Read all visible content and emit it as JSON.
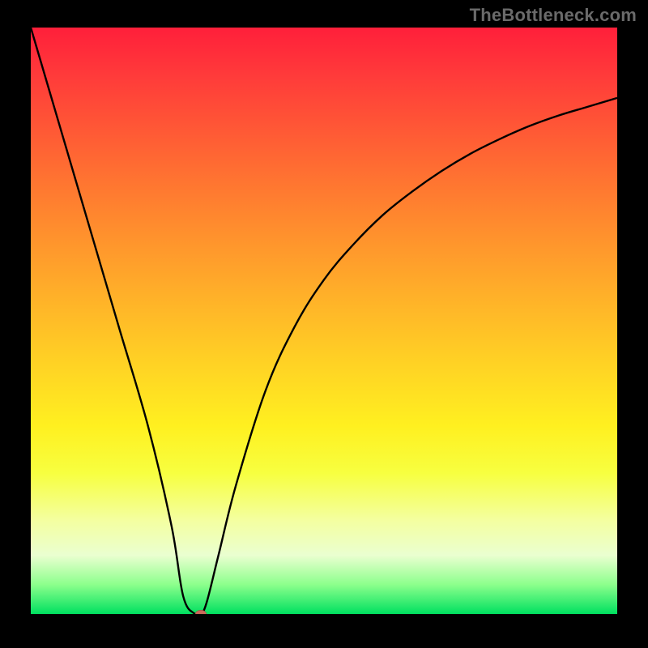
{
  "watermark": "TheBottleneck.com",
  "colors": {
    "page_bg": "#000000",
    "watermark": "#6a6a6a",
    "curve": "#000000",
    "marker": "#c96a5a",
    "gradient_stops": [
      "#ff1f3a",
      "#ff3a3a",
      "#ff5a35",
      "#ff7a30",
      "#ff992c",
      "#ffb728",
      "#ffd424",
      "#fff020",
      "#f7ff40",
      "#f4ffa0",
      "#eaffd0",
      "#8cff8c",
      "#00e060"
    ]
  },
  "chart_data": {
    "type": "line",
    "title": "",
    "xlabel": "",
    "ylabel": "",
    "xlim": [
      0,
      100
    ],
    "ylim": [
      0,
      100
    ],
    "grid": false,
    "legend": false,
    "x": [
      0,
      5,
      10,
      15,
      20,
      24,
      26,
      28,
      29,
      30,
      32,
      35,
      40,
      45,
      50,
      55,
      60,
      65,
      70,
      75,
      80,
      85,
      90,
      95,
      100
    ],
    "series": [
      {
        "name": "curve",
        "color": "#000000",
        "values": [
          100,
          83,
          66,
          49,
          32,
          15,
          3,
          0,
          0,
          2,
          10,
          22,
          38,
          49,
          57,
          63,
          68,
          72,
          75.5,
          78.5,
          81,
          83.2,
          85,
          86.5,
          88
        ]
      }
    ],
    "marker": {
      "x": 29,
      "y": 0
    }
  }
}
